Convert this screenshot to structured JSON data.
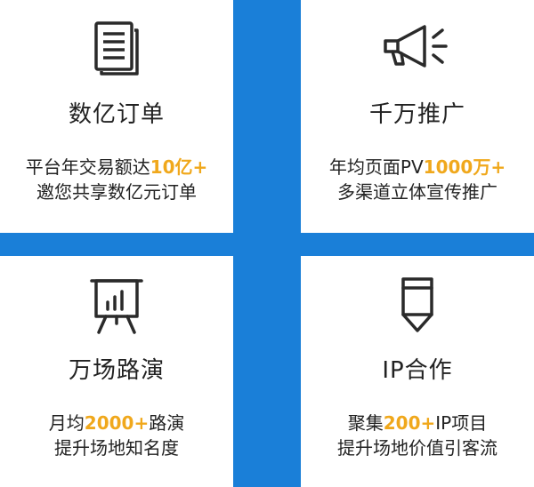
{
  "colors": {
    "background": "#1a7fd8",
    "card": "#ffffff",
    "text": "#222222",
    "highlight": "#f0a81c"
  },
  "cards": [
    {
      "icon": "document-icon",
      "title": "数亿订单",
      "line1": {
        "pre": "平台年交易额达",
        "hl": "10亿+",
        "post": ""
      },
      "line2": "邀您共享数亿元订单"
    },
    {
      "icon": "megaphone-icon",
      "title": "千万推广",
      "line1": {
        "pre": "年均页面PV",
        "hl": "1000万+",
        "post": ""
      },
      "line2": "多渠道立体宣传推广"
    },
    {
      "icon": "presentation-board-icon",
      "title": "万场路演",
      "line1": {
        "pre": "月均",
        "hl": "2000+",
        "post": "路演"
      },
      "line2": "提升场地知名度"
    },
    {
      "icon": "pencil-icon",
      "title": "IP合作",
      "line1": {
        "pre": "聚集",
        "hl": "200+",
        "post": "IP项目"
      },
      "line2": "提升场地价值引客流"
    }
  ]
}
